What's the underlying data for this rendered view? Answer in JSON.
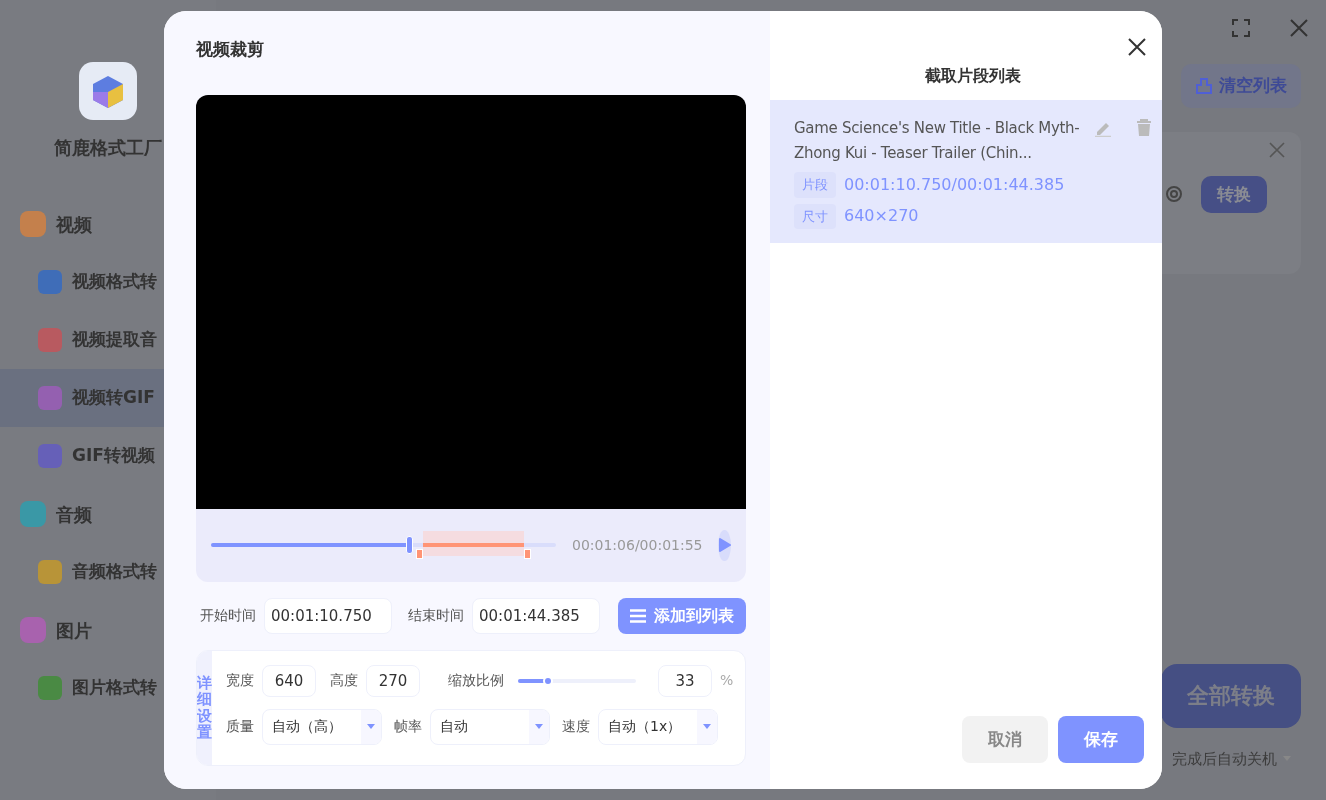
{
  "app": {
    "name": "简鹿格式工厂",
    "sidebar": [
      {
        "label": "视频",
        "kind": "section",
        "color": "#c4804c",
        "selected": false
      },
      {
        "label": "视频格式转",
        "kind": "item",
        "color": "#3f6db8",
        "selected": false
      },
      {
        "label": "视频提取音",
        "kind": "item",
        "color": "#b85a60",
        "selected": false
      },
      {
        "label": "视频转GIF",
        "kind": "item",
        "color": "#9460b0",
        "selected": true
      },
      {
        "label": "GIF转视频",
        "kind": "item",
        "color": "#6660b8",
        "selected": false
      },
      {
        "label": "音频",
        "kind": "section",
        "color": "#3a98a6",
        "selected": false
      },
      {
        "label": "音频格式转",
        "kind": "item",
        "color": "#b89438",
        "selected": false
      },
      {
        "label": "图片",
        "kind": "section",
        "color": "#a862ae",
        "selected": false
      },
      {
        "label": "图片格式转",
        "kind": "item",
        "color": "#4a8a44",
        "selected": false
      }
    ],
    "clear_button": "清空列表",
    "task_convert_button": "转换",
    "convert_all_button": "全部转换",
    "shutdown_option": "完成后自动关机"
  },
  "dialog": {
    "title": "视频裁剪",
    "playback": {
      "level": 0.574,
      "time": "00:01:06/00:01:55"
    },
    "start": {
      "label": "开始时间",
      "value": "00:01:10.750"
    },
    "end": {
      "label": "结束时间",
      "value": "00:01:44.385"
    },
    "add_button": "添加到列表",
    "settings": {
      "label": "详细设置",
      "width": {
        "label": "宽度",
        "value": "640"
      },
      "height": {
        "label": "高度",
        "value": "270"
      },
      "scale": {
        "label": "缩放比例",
        "level": 0.25,
        "value": "33",
        "unit": "%"
      },
      "selects": [
        {
          "label": "质量",
          "value": "自动（高）"
        },
        {
          "label": "帧率",
          "value": "自动"
        },
        {
          "label": "速度",
          "value": "自动（1x）"
        }
      ]
    },
    "clip_list": {
      "title": "截取片段列表",
      "clips": [
        {
          "name": "Game Science's New Title - Black Myth- Zhong Kui - Teaser Trailer (Chin...",
          "selected": true,
          "segment_label": "片段",
          "segment": "00:01:10.750/00:01:44.385",
          "size_label": "尺寸",
          "size": "640×270"
        }
      ]
    },
    "cancel_button": "取消",
    "save_button": "保存"
  }
}
